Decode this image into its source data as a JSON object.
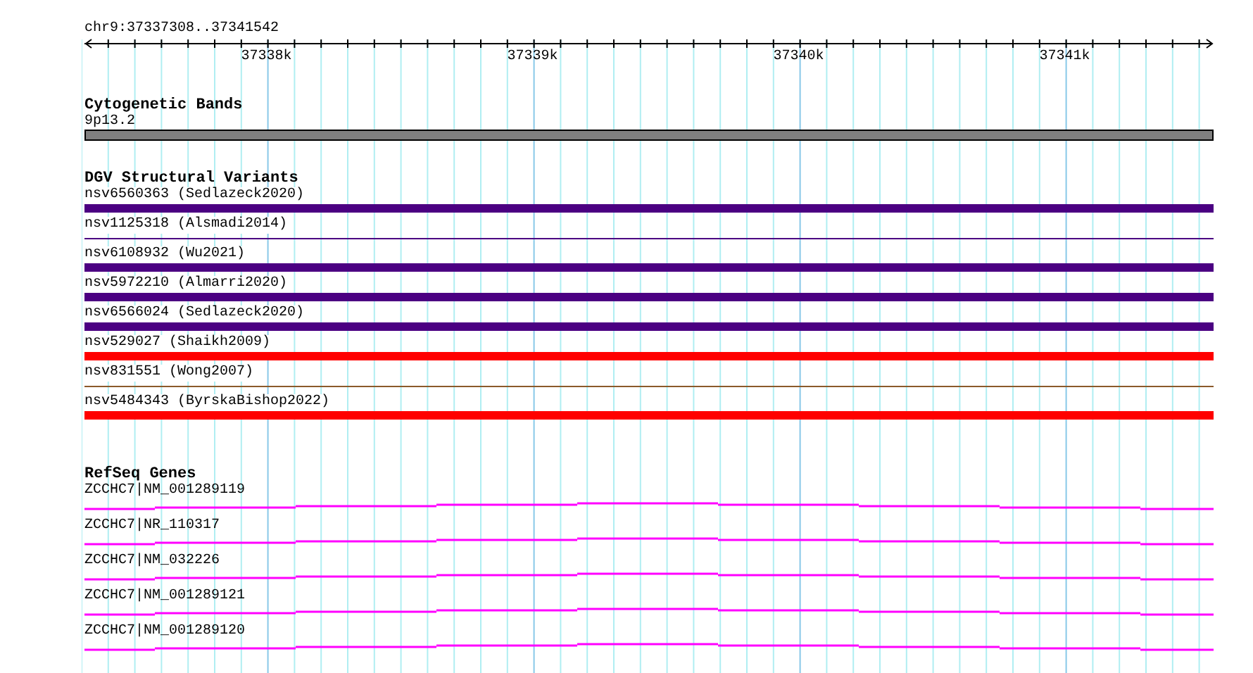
{
  "ruler": {
    "title": "chr9:37337308..37341542",
    "labels": [
      "37338k",
      "37339k",
      "37340k",
      "37341k"
    ]
  },
  "cytogenetic_bands": {
    "title": "Cytogenetic Bands",
    "items": [
      {
        "name": "9p13.2",
        "color": "#808080"
      }
    ]
  },
  "dgv_variants": {
    "title": "DGV Structural Variants",
    "items": [
      {
        "name": "nsv6560363 (Sedlazeck2020)",
        "kind": "thick",
        "color": "#4b0082"
      },
      {
        "name": "nsv1125318 (Alsmadi2014)",
        "kind": "thin",
        "color": "#4b0082"
      },
      {
        "name": "nsv6108932 (Wu2021)",
        "kind": "thick",
        "color": "#4b0082"
      },
      {
        "name": "nsv5972210 (Almarri2020)",
        "kind": "thick",
        "color": "#4b0082"
      },
      {
        "name": "nsv6566024 (Sedlazeck2020)",
        "kind": "thick",
        "color": "#4b0082"
      },
      {
        "name": "nsv529027 (Shaikh2009)",
        "kind": "thick",
        "color": "#ff0000"
      },
      {
        "name": "nsv831551 (Wong2007)",
        "kind": "thin",
        "color": "#8b5a2b"
      },
      {
        "name": "nsv5484343 (ByrskaBishop2022)",
        "kind": "thick",
        "color": "#ff0000"
      }
    ]
  },
  "refseq_genes": {
    "title": "RefSeq Genes",
    "items": [
      {
        "name": "ZCCHC7|NM_001289119"
      },
      {
        "name": "ZCCHC7|NR_110317"
      },
      {
        "name": "ZCCHC7|NM_032226"
      },
      {
        "name": "ZCCHC7|NM_001289121"
      },
      {
        "name": "ZCCHC7|NM_001289120"
      }
    ]
  }
}
